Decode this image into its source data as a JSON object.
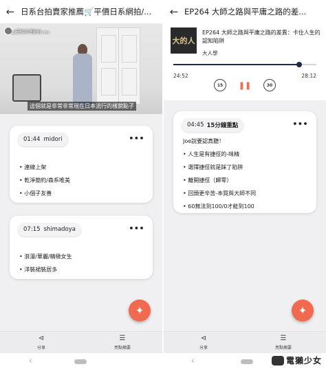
{
  "left": {
    "title": "日系台拍賣家推薦🛒平價日系網拍/...",
    "video": {
      "channel_name": "shimadoya",
      "channel_subtitle": "嘉義日系行·洋裝 11,450",
      "caption": "這個就是非常非常現在日本流行的樣貌點子"
    },
    "cards": [
      {
        "time": "01:44",
        "speaker": "midori",
        "lines": [
          "• 連線上架",
          "• 乾淨簡約/森系唯美",
          "• 小個子友善"
        ]
      },
      {
        "time": "07:15",
        "speaker": "shimadoya",
        "lines": [
          "• 浪漫/華麗/精緻女生",
          "• 洋裝裙裝居多"
        ]
      }
    ],
    "fab_icon": "sparkle-icon",
    "bottom": {
      "share_label": "分享",
      "highlights_label": "亮點摘要"
    }
  },
  "right": {
    "title": "EP264 大師之路與平庸之路的差...",
    "player": {
      "cover_text": "大的人",
      "episode_title": "EP264 大師之路與平庸之路的差異：卡住人生的認知陷阱",
      "author": "大人學",
      "elapsed": "24:52",
      "remaining": "28:12",
      "progress": 0.88,
      "rewind_label": "15",
      "forward_label": "30"
    },
    "card": {
      "time": "04:45",
      "heading": "15分鐘重點",
      "lines": [
        "Joe說要認真聽！",
        "• 人生是有捷徑的-味精",
        "• 選擇捷徑就是踩了陷阱",
        "• 離開捷徑（歸零）",
        "• 回頭更辛苦-本質與大師不同",
        "• 60無法到100/0才能到100"
      ]
    },
    "fab_icon": "sparkle-icon",
    "bottom": {
      "share_label": "分享",
      "highlights_label": "亮點摘要"
    }
  },
  "watermark": "電獺少女",
  "colors": {
    "accent": "#f06a50",
    "progress": "#1f2a44",
    "background": "#f0f0f2"
  }
}
